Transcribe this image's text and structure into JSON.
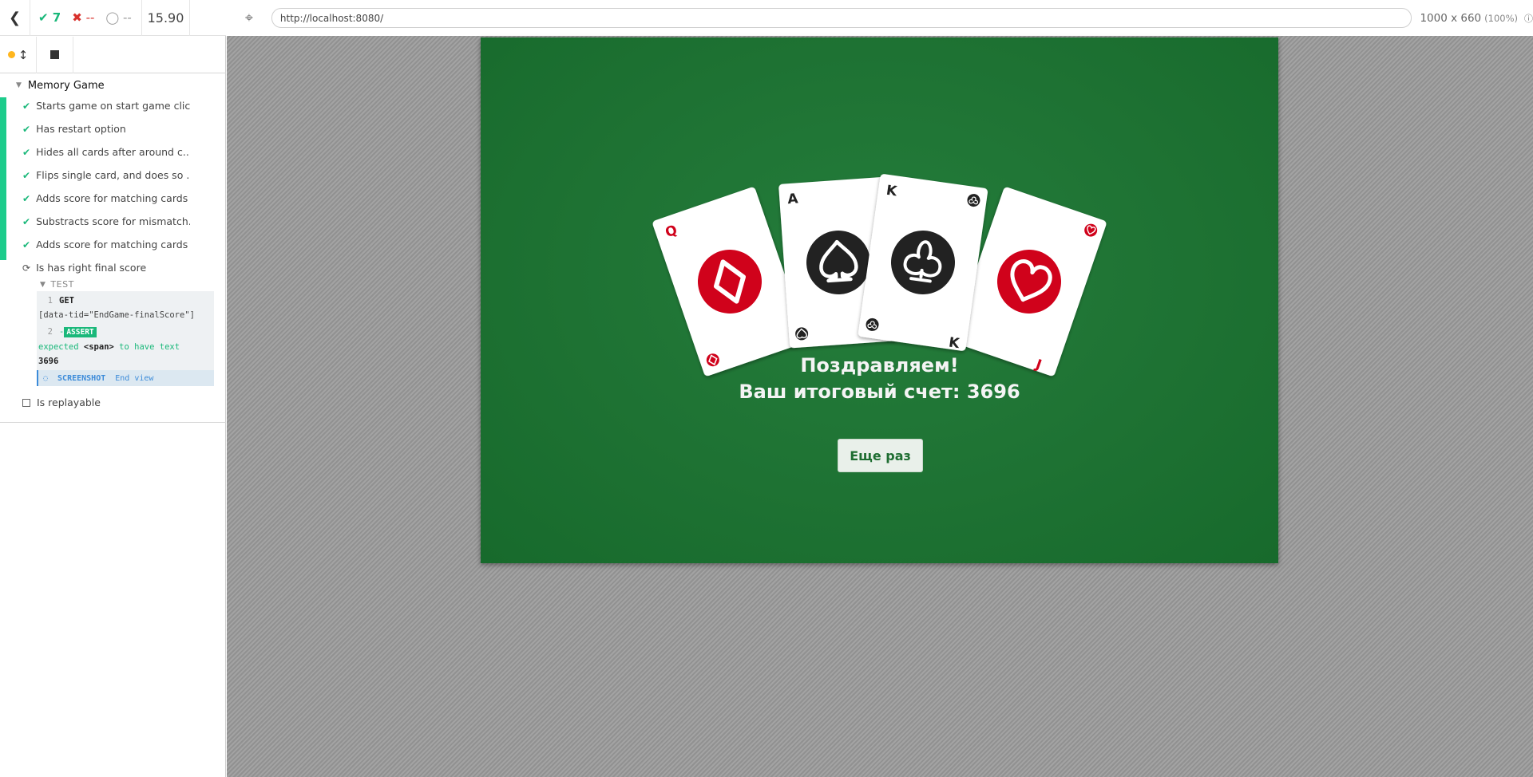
{
  "stats": {
    "passed": "7",
    "failed": "--",
    "pending": "--",
    "duration": "15.90"
  },
  "suite": {
    "title": "Memory Game"
  },
  "tests": [
    "Starts game on start game click",
    "Has restart option",
    "Hides all cards after around c...",
    "Flips single card, and does so ...",
    "Adds score for matching cards",
    "Substracts score for mismatch...",
    "Adds score for matching cards",
    "Is has right final score"
  ],
  "command_log": {
    "section": "TEST",
    "cmd1_num": "1",
    "cmd1_name": "GET",
    "cmd1_arg": "[data-tid=\"EndGame-finalScore\"]",
    "cmd2_num": "2",
    "cmd2_prefix": "-",
    "cmd2_badge": "ASSERT",
    "cmd2_text1": "expected",
    "cmd2_el": "<span>",
    "cmd2_text2": "to have text",
    "cmd2_value": "3696",
    "shot_label": "SCREENSHOT",
    "shot_text": "End view"
  },
  "replay_label": "Is replayable",
  "aut": {
    "url": "http://localhost:8080/",
    "viewport": "1000 x 660",
    "zoom": "(100%)"
  },
  "game": {
    "congrats_line1": "Поздравляем!",
    "congrats_line2": "Ваш итоговый счет: 3696",
    "again_button": "Еще раз",
    "cards": [
      {
        "rank": "Q",
        "suit": "diamond",
        "color": "#d0021b"
      },
      {
        "rank": "A",
        "suit": "spade",
        "color": "#222"
      },
      {
        "rank": "K",
        "suit": "club",
        "color": "#222"
      },
      {
        "rank": "J",
        "suit": "heart",
        "color": "#d0021b"
      }
    ]
  },
  "colors": {
    "table_green": "#1e7233",
    "pass_green": "#1dcc8c",
    "card_red": "#d0021b"
  }
}
